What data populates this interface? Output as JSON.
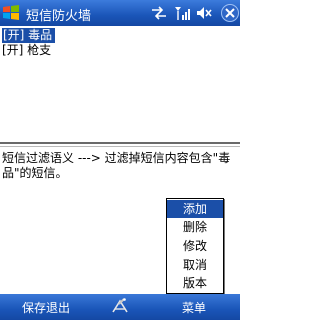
{
  "window": {
    "title": "短信防火墙"
  },
  "status_icons": [
    "connectivity-icon",
    "signal-icon",
    "volume-icon",
    "close-icon"
  ],
  "list": {
    "items": [
      {
        "label": "[开] 毒品",
        "selected": true
      },
      {
        "label": "[开] 枪支",
        "selected": false
      }
    ]
  },
  "description": {
    "text": "短信过滤语义 ---> 过滤掉短信内容包含\"毒品\"的短信。"
  },
  "menu": {
    "items": [
      {
        "label": "添加",
        "active": true
      },
      {
        "label": "删除",
        "active": false
      },
      {
        "label": "修改",
        "active": false
      },
      {
        "label": "取消",
        "active": false
      },
      {
        "label": "版本",
        "active": false
      }
    ]
  },
  "softkeys": {
    "left": "保存退出",
    "right": "菜单"
  },
  "colors": {
    "titlebar": "#1a55b8",
    "selection": "#1b4fa8"
  }
}
